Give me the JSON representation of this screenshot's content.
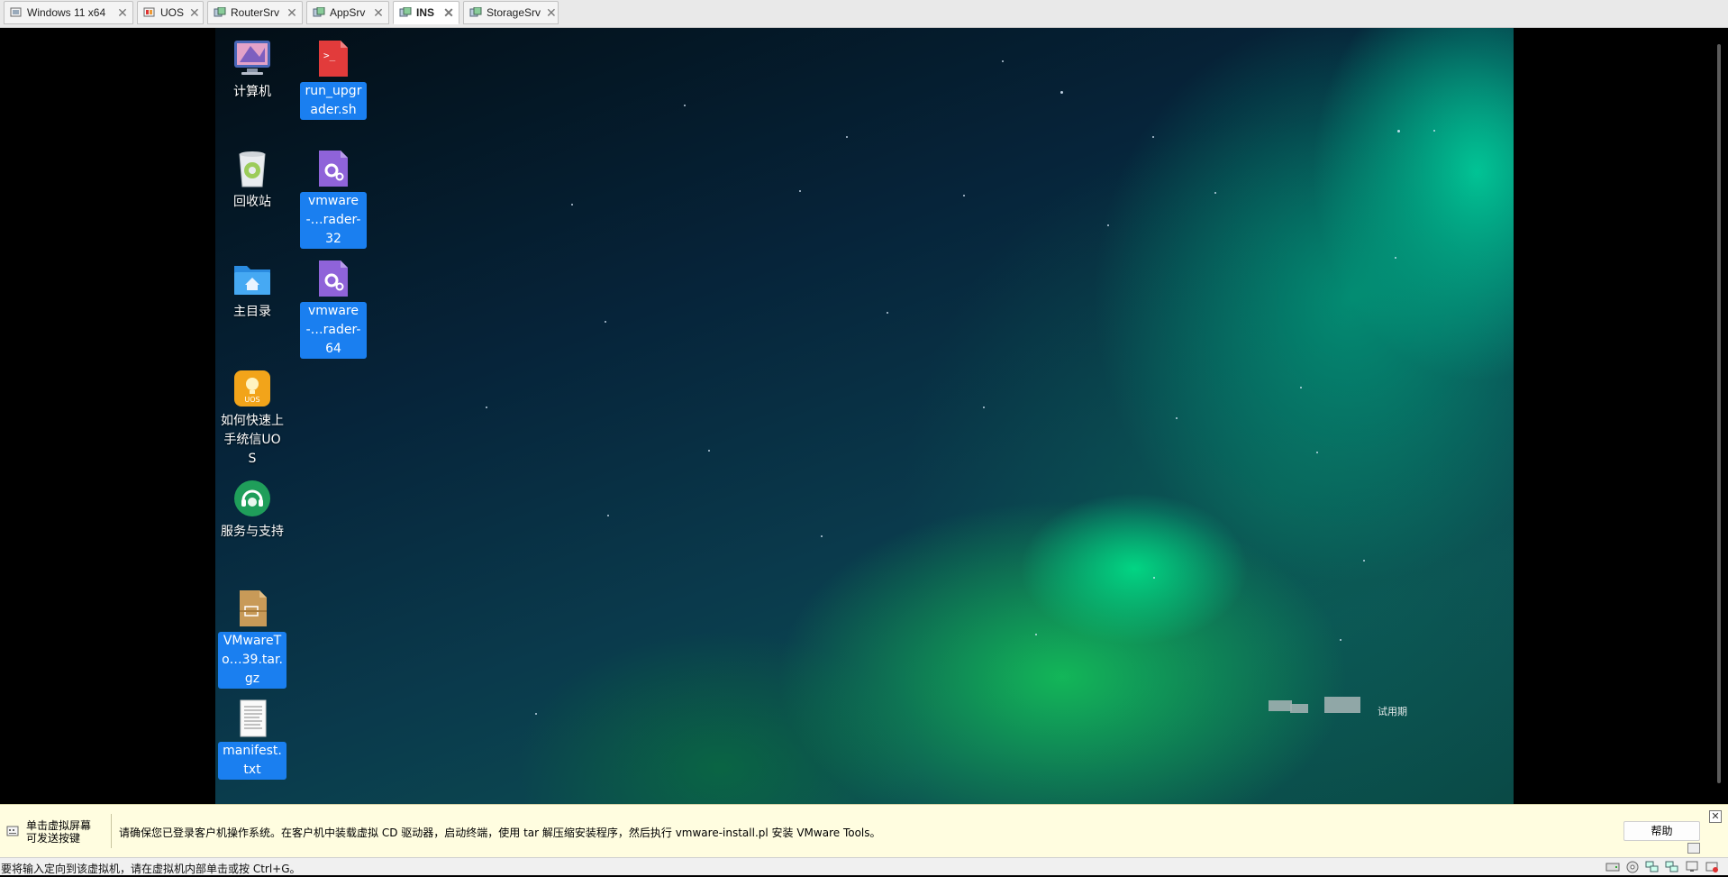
{
  "tabs": [
    {
      "label": "Windows 11 x64",
      "icon": "windows-vm-icon",
      "active": false
    },
    {
      "label": "UOS",
      "icon": "linux-vm-icon",
      "active": false
    },
    {
      "label": "RouterSrv",
      "icon": "server-vm-icon",
      "active": false
    },
    {
      "label": "AppSrv",
      "icon": "server-vm-icon",
      "active": false
    },
    {
      "label": "INS",
      "icon": "server-vm-icon",
      "active": true
    },
    {
      "label": "StorageSrv",
      "icon": "server-vm-icon",
      "active": false
    }
  ],
  "desktop": {
    "icons": [
      {
        "label": "计算机",
        "icon": "computer-icon",
        "selected": false
      },
      {
        "label": "回收站",
        "icon": "recycle-bin-icon",
        "selected": false
      },
      {
        "label": "主目录",
        "icon": "home-folder-icon",
        "selected": false
      },
      {
        "label": "如何快速上手统信UOS",
        "icon": "uos-guide-icon",
        "selected": false
      },
      {
        "label": "服务与支持",
        "icon": "support-headset-icon",
        "selected": false
      },
      {
        "label": "VMwareTo…39.tar.gz",
        "icon": "archive-icon",
        "selected": true
      },
      {
        "label": "manifest.txt",
        "icon": "text-file-icon",
        "selected": true
      },
      {
        "label": "run_upgrader.sh",
        "icon": "shell-script-icon",
        "selected": true
      },
      {
        "label": "vmware-…rader-32",
        "icon": "executable-gear-icon",
        "selected": true
      },
      {
        "label": "vmware-…rader-64",
        "icon": "executable-gear-icon",
        "selected": true
      }
    ],
    "watermark_text": "试用期"
  },
  "notification": {
    "left_text_line1": "单击虚拟屏幕",
    "left_text_line2": "可发送按键",
    "message": "请确保您已登录客户机操作系统。在客户机中装载虚拟 CD 驱动器，启动终端，使用 tar 解压缩安装程序，然后执行 vmware-install.pl 安装 VMware Tools。",
    "help_label": "帮助",
    "close_glyph": "✕"
  },
  "statusbar": {
    "text": "要将输入定向到该虚拟机，请在虚拟机内部单击或按 Ctrl+G。"
  },
  "colors": {
    "selection": "#1a7ff0",
    "notify_bg": "#fffde0"
  }
}
